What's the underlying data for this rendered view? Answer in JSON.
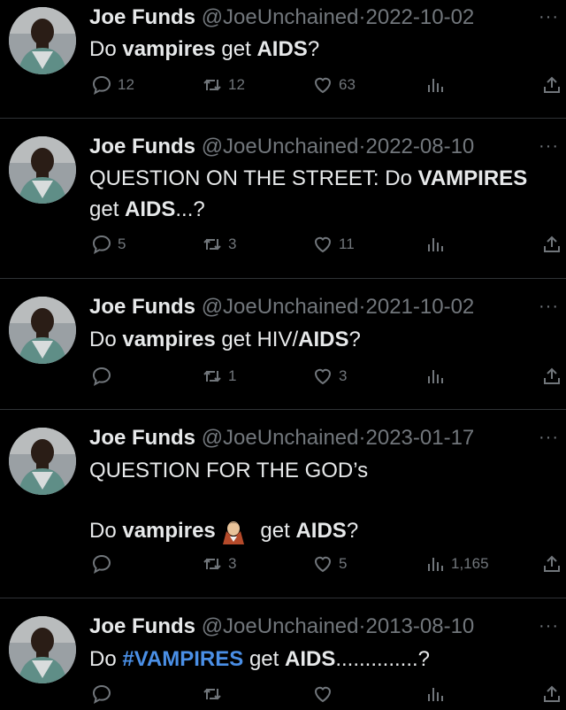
{
  "tweets": [
    {
      "name": "Joe Funds",
      "handle": "@JoeUnchained",
      "date": "2022-10-02",
      "text_parts": [
        "Do ",
        "vampires",
        " get ",
        "AIDS",
        "?"
      ],
      "replies": "12",
      "retweets": "12",
      "likes": "63",
      "views": ""
    },
    {
      "name": "Joe Funds",
      "handle": "@JoeUnchained",
      "date": "2022-08-10",
      "text_line1": [
        "QUESTION ON THE STREET: Do ",
        "VAMPIRES"
      ],
      "text_line2": [
        "get ",
        "AIDS",
        "...?"
      ],
      "replies": "5",
      "retweets": "3",
      "likes": "11",
      "views": ""
    },
    {
      "name": "Joe Funds",
      "handle": "@JoeUnchained",
      "date": "2021-10-02",
      "text_parts": [
        "Do ",
        "vampires",
        " get HIV/",
        "AIDS",
        "?"
      ],
      "replies": "",
      "retweets": "1",
      "likes": "3",
      "views": ""
    },
    {
      "name": "Joe Funds",
      "handle": "@JoeUnchained",
      "date": "2023-01-17",
      "text_line1": "QUESTION FOR THE GOD’s",
      "text_line3": [
        "Do ",
        "vampires",
        " get ",
        "AIDS",
        "?"
      ],
      "emoji": "vampire-emoji",
      "replies": "",
      "retweets": "3",
      "likes": "5",
      "views": "1,165"
    },
    {
      "name": "Joe Funds",
      "handle": "@JoeUnchained",
      "date": "2013-08-10",
      "text_parts": [
        "Do ",
        "#VAMPIRES",
        " get ",
        "AIDS",
        "..............?"
      ],
      "replies": "",
      "retweets": "",
      "likes": "",
      "views": ""
    }
  ],
  "separator": "·",
  "more": "···",
  "icons": [
    "reply-icon",
    "retweet-icon",
    "like-icon",
    "views-icon",
    "share-icon",
    "more-icon"
  ],
  "colors": {
    "background": "#000000",
    "text": "#e7e9ea",
    "muted": "#71767b",
    "hashtag": "#4a8fe6"
  }
}
